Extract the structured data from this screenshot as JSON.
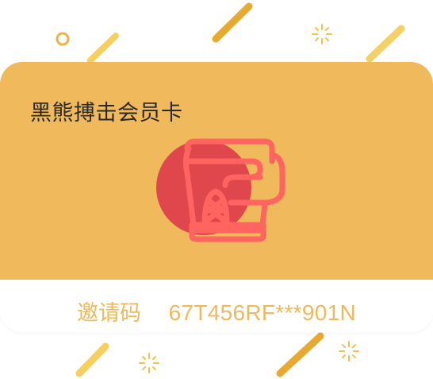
{
  "card": {
    "title": "黑熊搏击会员卡",
    "invite_label": "邀请码",
    "invite_code": "67T456RF***901N",
    "emblem": "boxing-glove-icon"
  },
  "colors": {
    "card_gold": "#f0b95b",
    "invite_text": "#edb95c",
    "glove_stroke": "#ff6460",
    "glove_circle": "#e0474c",
    "title_text": "#2a2a2a"
  }
}
